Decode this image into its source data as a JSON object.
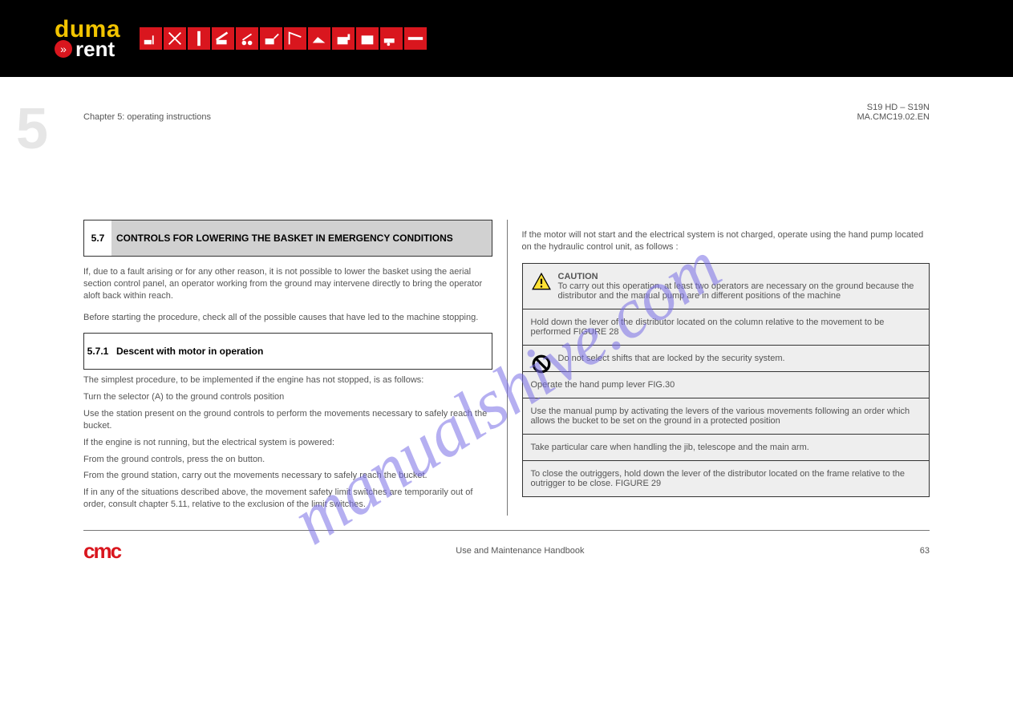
{
  "banner": {
    "logo_top": "duma",
    "logo_bottom": "rent",
    "icons": [
      "forklift-icon",
      "scissor-lift-icon",
      "boom-lift-icon",
      "telehandler-icon",
      "excavator-icon",
      "loader-icon",
      "crane-icon",
      "dumper-icon",
      "generator-icon",
      "compressor-icon",
      "trailer-icon",
      "misc-icon"
    ]
  },
  "page_meta": {
    "chapter_num_bg": "5",
    "chapter_line": "Chapter 5: operating instructions",
    "machine_ref": "S19 HD – S19N",
    "doc_code": "MA.CMC19.02.EN"
  },
  "left": {
    "section1": {
      "num": "5.7",
      "title": "CONTROLS FOR LOWERING THE BASKET IN EMERGENCY CONDITIONS"
    },
    "para1": "If, due to a fault arising or for any other reason, it is not possible to lower the basket using the aerial section control panel, an operator working from the ground may intervene directly to bring the operator aloft back within reach.",
    "para2": "Before starting the procedure, check all of the possible causes that have led to the machine stopping.",
    "section2": {
      "num": "5.7.1",
      "title": "Descent with motor in operation"
    },
    "steps": {
      "s1": "The simplest procedure, to be implemented if the engine has not stopped, is as follows:",
      "s2": "Turn the selector (A) to the ground controls position",
      "s3": "Use the station present on the ground controls to perform the movements necessary to safely reach the bucket.",
      "s4": "If the engine is not running, but the electrical system is powered:",
      "s5": "From the ground controls, press the on button.",
      "s6": "From the ground station, carry out the movements necessary to safely reach the bucket.",
      "s7": "If in any of the situations described above, the movement safety limit switches are temporarily out of order, consult chapter 5.11, relative to the exclusion of the limit switches."
    }
  },
  "right": {
    "intro": "If the motor will not start and the electrical system is not charged, operate using the hand pump located on the hydraulic control unit, as follows :",
    "rows": {
      "r1a": "CAUTION",
      "r1b": "To carry out this operation, at least two operators are necessary on the ground because the distributor and the manual pump are in different positions of the machine",
      "r2": "Hold down the lever of the distributor located on the column relative to the movement to be performed FIGURE 28",
      "r3": "Do not select shifts that are locked by the security system.",
      "r4": "Operate the hand pump lever FIG.30",
      "r5": "Use the manual pump by activating the levers of the various movements following an order which allows the bucket to be set on the ground in a protected position",
      "r6": "Take particular care when handling the jib, telescope and the main arm.",
      "r7": "To close the outriggers, hold down the lever of the distributor located on the frame relative to the outrigger to be close. FIGURE 29"
    }
  },
  "footer": {
    "logo": "cmc",
    "center": "Use and Maintenance Handbook",
    "page": "63"
  },
  "watermark": "manualshive.com"
}
